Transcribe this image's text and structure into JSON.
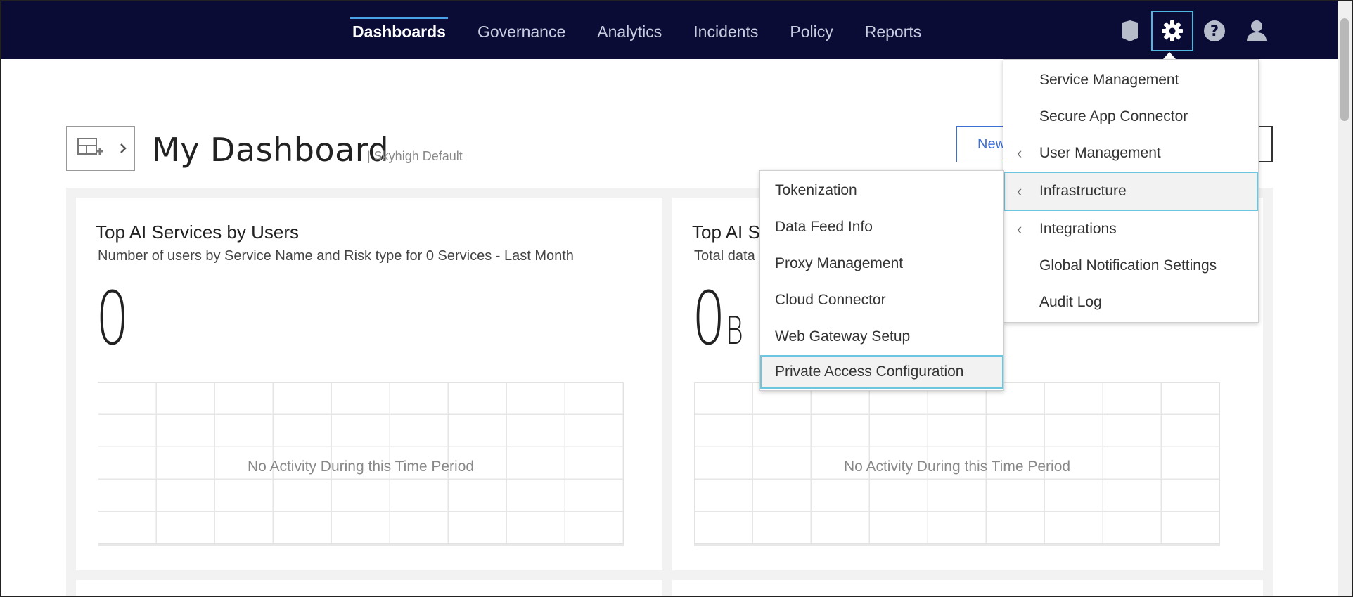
{
  "nav": {
    "items": [
      {
        "label": "Dashboards",
        "active": true
      },
      {
        "label": "Governance",
        "active": false
      },
      {
        "label": "Analytics",
        "active": false
      },
      {
        "label": "Incidents",
        "active": false
      },
      {
        "label": "Policy",
        "active": false
      },
      {
        "label": "Reports",
        "active": false
      }
    ],
    "icons": [
      "shield-icon",
      "gear-icon",
      "help-icon",
      "user-icon"
    ]
  },
  "dashboard": {
    "title": "My Dashboard",
    "subtitle": "| Skyhigh Default",
    "new_button_label": "New"
  },
  "cards": [
    {
      "title": "Top AI Services by Users",
      "subtitle": "Number of users by Service Name and Risk type for 0 Services - Last Month",
      "value": "0",
      "unit": "",
      "empty_message": "No Activity During this Time Period"
    },
    {
      "title": "Top AI S",
      "subtitle": "Total data",
      "value": "0",
      "unit": "B",
      "empty_message": "No Activity During this Time Period"
    }
  ],
  "settings_menu": {
    "items": [
      {
        "label": "Service Management",
        "submenu": false
      },
      {
        "label": "Secure App Connector",
        "submenu": false
      },
      {
        "label": "User Management",
        "submenu": true
      },
      {
        "label": "Infrastructure",
        "submenu": true,
        "highlighted": true
      },
      {
        "label": "Integrations",
        "submenu": true
      },
      {
        "label": "Global Notification Settings",
        "submenu": false
      },
      {
        "label": "Audit Log",
        "submenu": false
      }
    ]
  },
  "infrastructure_submenu": {
    "items": [
      {
        "label": "Tokenization"
      },
      {
        "label": "Data Feed Info"
      },
      {
        "label": "Proxy Management"
      },
      {
        "label": "Cloud Connector"
      },
      {
        "label": "Web Gateway Setup"
      },
      {
        "label": "Private Access Configuration",
        "highlighted": true
      }
    ]
  },
  "colors": {
    "topbar": "#0b0c36",
    "accent": "#4fb8e0",
    "link": "#3b6fd8"
  }
}
